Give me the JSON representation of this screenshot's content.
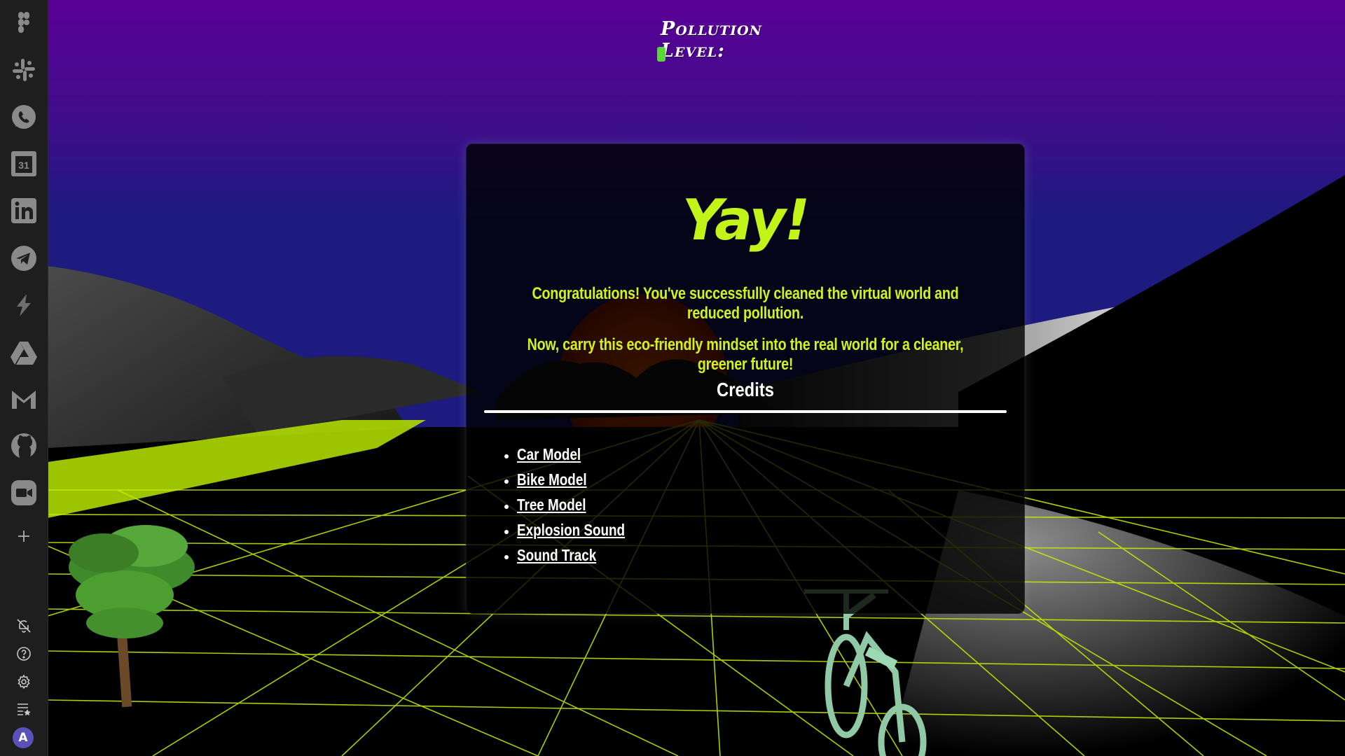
{
  "dock": {
    "apps": [
      {
        "name": "figma-icon"
      },
      {
        "name": "slack-icon"
      },
      {
        "name": "whatsapp-icon"
      },
      {
        "name": "calendar-icon",
        "label": "31"
      },
      {
        "name": "linkedin-icon"
      },
      {
        "name": "telegram-icon"
      },
      {
        "name": "app-s-icon"
      },
      {
        "name": "google-drive-icon"
      },
      {
        "name": "gmail-icon"
      },
      {
        "name": "github-icon"
      },
      {
        "name": "zoom-icon"
      },
      {
        "name": "add-icon"
      }
    ],
    "avatar_letter": "A"
  },
  "hud": {
    "pollution_label": "Pollution Level:",
    "pollution_level": 0.04,
    "bar_color": "#5ed23c"
  },
  "dialog": {
    "title": "Yay!",
    "message_1": "Congratulations! You've successfully cleaned the virtual world and reduced pollution.",
    "message_2": "Now, carry this eco-friendly mindset into the real world for a cleaner, greener future!",
    "credits_heading": "Credits",
    "credits": [
      {
        "label": "Car Model"
      },
      {
        "label": "Bike Model"
      },
      {
        "label": "Tree Model"
      },
      {
        "label": "Explosion Sound"
      },
      {
        "label": "Sound Track"
      }
    ]
  },
  "colors": {
    "accent": "#c2f41a",
    "sky_top": "#5a0096",
    "sky_bottom": "#1d1a80",
    "grid": "#c8f000"
  }
}
